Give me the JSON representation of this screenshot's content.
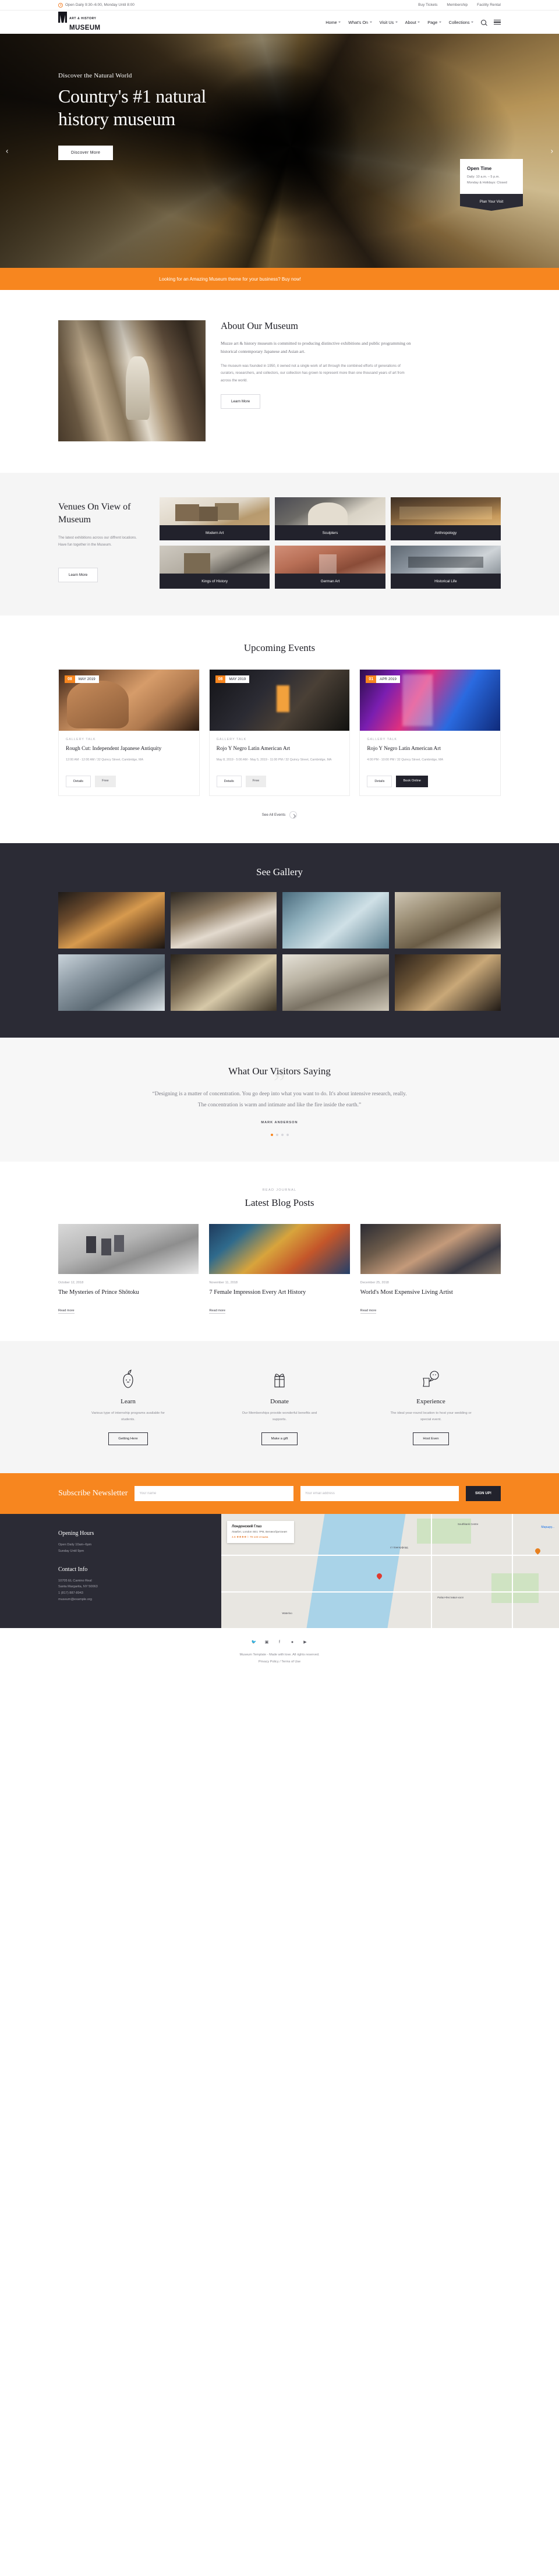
{
  "topbar": {
    "hours": "Open Daily 9:30–6:00, Monday Until 8:00",
    "links": [
      "Buy Tickets",
      "Membership",
      "Facility Rental"
    ]
  },
  "header": {
    "logo_top": "ART & HISTORY",
    "logo_bottom": "MUSEUM",
    "nav": [
      "Home",
      "What's On",
      "Visit Us",
      "About",
      "Page",
      "Collections"
    ]
  },
  "hero": {
    "kicker": "Discover the Natural World",
    "title": "Country's #1 natural history museum",
    "button": "Discover More",
    "prev": "‹",
    "next": "›",
    "open_card": {
      "title": "Open Time",
      "line1": "Daily: 10 a.m. – 5 p.m.",
      "line2": "Monday & Holidays: Closed",
      "button": "Plan Your Visit"
    }
  },
  "promo": {
    "text": "Looking for an Amazing Museum theme for your business? Buy now!"
  },
  "about": {
    "title": "About Our Museum",
    "lead": "Muzze art & history museum is committed to producing distinctive exhibitions and public programming on historical contemporary Japanese and Asian art.",
    "body": "The museum was founded in 1950, it owned not a single work of art through the combined efforts of generations of curators, researchers, and collectors, our collection has grown to represent more than one thousand years of art from across the world.",
    "button": "Learn More"
  },
  "venues": {
    "title": "Venues On View of Museum",
    "desc": "The latest exhibitions across our diffrent locations. Have fun together in the Museum.",
    "button": "Learn More",
    "items": [
      {
        "label": "Modern Art"
      },
      {
        "label": "Sculpters"
      },
      {
        "label": "Anthropology"
      },
      {
        "label": "Kings of History"
      },
      {
        "label": "German Art"
      },
      {
        "label": "Historical Life"
      }
    ]
  },
  "events": {
    "title": "Upcoming Events",
    "see_all": "See All Events",
    "cards": [
      {
        "day": "08",
        "month": "MAY 2019",
        "category": "GALLERY TALK",
        "title": "Rough Cut: Independent Japanese Antiquity",
        "meta": "12:00 AM - 12:00 AM / 32 Quincy Street, Cambridge, MA",
        "btn1": "Details",
        "btn2": "Free",
        "btn2_style": "grey"
      },
      {
        "day": "08",
        "month": "MAY 2019",
        "category": "GALLERY TALK",
        "title": "Rojo Y Negro Latin American Art",
        "meta": "May 8, 2019 - 5:00 AM - May 5, 2019 - 11:00 PM / 32 Quincy Street, Cambridge, MA",
        "btn1": "Details",
        "btn2": "Free",
        "btn2_style": "grey"
      },
      {
        "day": "01",
        "month": "APR 2019",
        "category": "GALLERY TALK",
        "title": "Rojo Y Negro Latin American Art",
        "meta": "4:00 PM - 10:00 PM / 32 Quincy Street, Cambridge, MA",
        "btn1": "Details",
        "btn2": "Book Online",
        "btn2_style": "dark"
      }
    ]
  },
  "gallery": {
    "title": "See Gallery"
  },
  "testimonial": {
    "title": "What Our Visitors Saying",
    "quote": "“Designing is a matter of concentration. You go deep into what you want to do. It's about intensive research, really. The concentration is warm and intimate and like the fire inside the earth.”",
    "author": "MARK ANDERSON"
  },
  "blog": {
    "kicker": "READ JOURNAL",
    "title": "Latest Blog Posts",
    "posts": [
      {
        "date": "October 12, 2018",
        "title": "The Mysteries of Prince Shōtoku",
        "more": "Read more"
      },
      {
        "date": "November 11, 2018",
        "title": "7 Female Impression Every Art History",
        "more": "Read more"
      },
      {
        "date": "December 25, 2018",
        "title": "World's Most Expensive Living Artist",
        "more": "Read more"
      }
    ]
  },
  "services": [
    {
      "icon": "apple-icon",
      "title": "Learn",
      "desc": "Various type of internship programs available for students.",
      "button": "Getting Here"
    },
    {
      "icon": "gift-icon",
      "title": "Donate",
      "desc": "Our Memberships provide wonderful benefits and supports.",
      "button": "Make a gift"
    },
    {
      "icon": "ticket-icon",
      "title": "Experience",
      "desc": "The ideal year-round location to host your wedding or special event.",
      "button": "Host Even"
    }
  ],
  "newsletter": {
    "title": "Subscribe Newsletter",
    "name_placeholder": "Your name",
    "email_placeholder": "Your email address",
    "button": "SIGN UP!"
  },
  "footer": {
    "hours_title": "Opening Hours",
    "hours_line1": "Open Daily 10am–6pm",
    "hours_line2": "Sunday Until 9pm",
    "contact_title": "Contact Info",
    "contact_line1": "10705 EL Camino Real",
    "contact_line2": "Santa Margarita, NY 50063",
    "contact_phone": "1 (817) 887-8943",
    "contact_email": "museum@example.org",
    "map_card_title": "Лондонский Глаз",
    "map_card_sub": "Ламбет, London SE1 7PB, Великобритания",
    "map_card_rating": "4.6 ★★★★☆  79 133 отзыва",
    "map_directions": "Маршру...",
    "map_labels": [
      "Southbank Centre",
      "ст Хангерфорд",
      "Ройал-Фестивал-холл",
      "Waterloo"
    ]
  },
  "bottom": {
    "socials": [
      "twitter-icon",
      "instagram-icon",
      "facebook-icon",
      "pinterest-icon",
      "youtube-icon"
    ],
    "copyright": "Museum Template - Made with love. All rights reserved.",
    "links": "Privacy Policy / Terms of Use",
    "accent": "#f7861f"
  }
}
